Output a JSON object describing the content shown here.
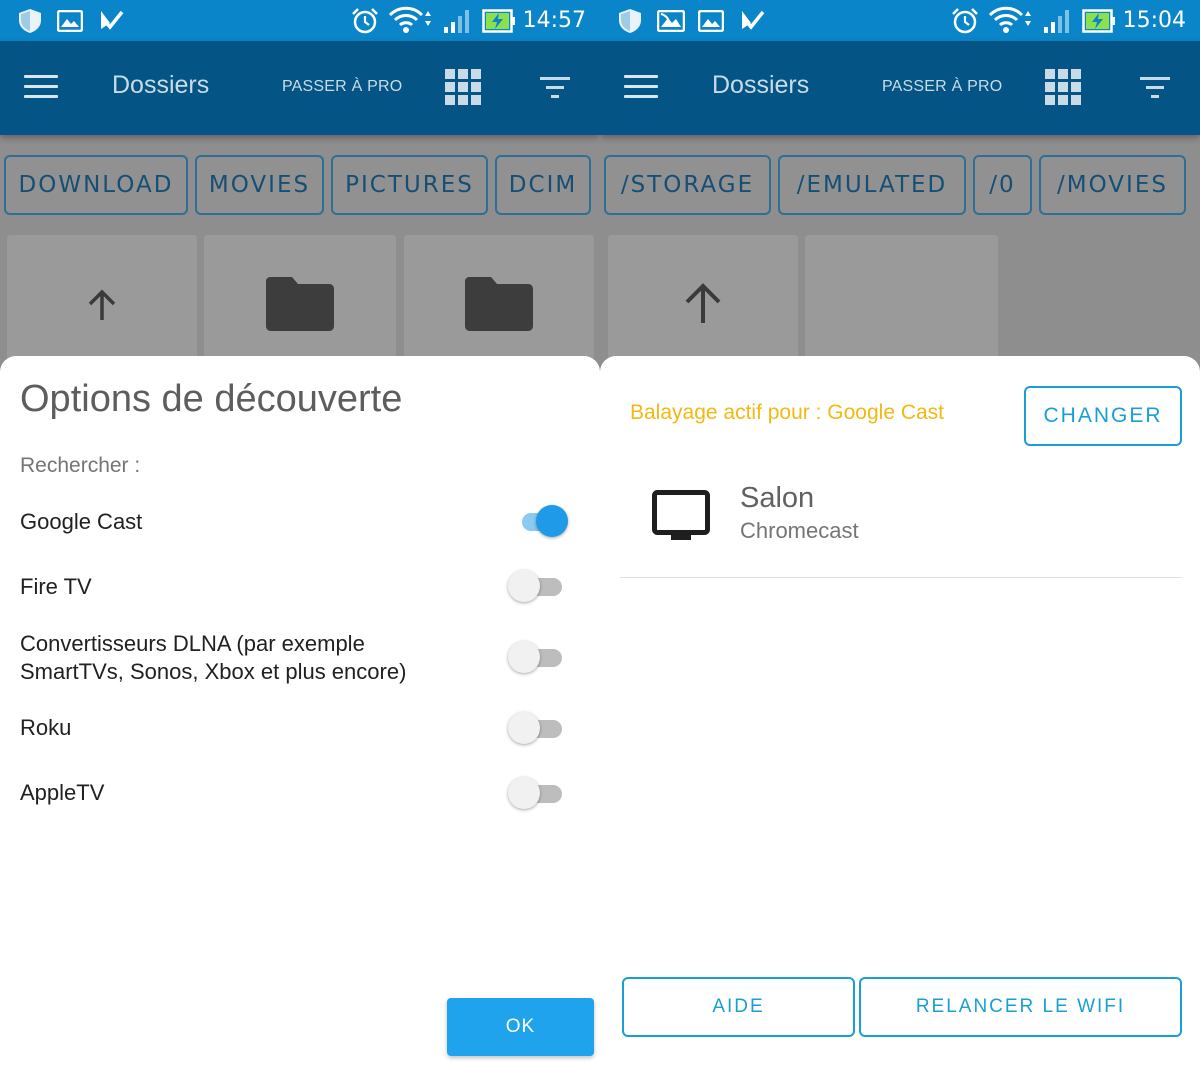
{
  "colors": {
    "status_bar": "#0b85c9",
    "app_bar": "#045585",
    "accent": "#1ea3ec",
    "scan_text": "#f3b814",
    "outline_button": "#1a9fd3"
  },
  "left": {
    "status": {
      "time": "14:57",
      "icons": [
        "shield-icon",
        "image-icon",
        "check-icon",
        "alarm-icon",
        "wifi-icon",
        "signal-icon",
        "battery-charging-icon"
      ]
    },
    "appbar": {
      "title": "Dossiers",
      "pro_label": "PASSER À PRO",
      "icons": [
        "menu-icon",
        "grid-view-icon",
        "filter-icon"
      ]
    },
    "breadcrumbs": [
      "DOWNLOAD",
      "MOVIES",
      "PICTURES",
      "DCIM"
    ],
    "tiles": [
      "arrow-up-icon",
      "folder-icon",
      "folder-icon"
    ],
    "dialog": {
      "title": "Options de découverte",
      "search_label": "Rechercher :",
      "options": [
        {
          "label": "Google Cast",
          "enabled": true
        },
        {
          "label": "Fire TV",
          "enabled": false
        },
        {
          "label_line1": "Convertisseurs DLNA (par exemple",
          "label_line2": "SmartTVs, Sonos, Xbox et plus encore)",
          "enabled": false
        },
        {
          "label": "Roku",
          "enabled": false
        },
        {
          "label": "AppleTV",
          "enabled": false
        }
      ],
      "ok_label": "OK"
    }
  },
  "right": {
    "status": {
      "time": "15:04",
      "icons": [
        "shield-icon",
        "cast-image-icon",
        "image-icon",
        "check-icon",
        "alarm-icon",
        "wifi-icon",
        "signal-icon",
        "battery-charging-icon"
      ]
    },
    "appbar": {
      "title": "Dossiers",
      "pro_label": "PASSER À PRO",
      "icons": [
        "menu-icon",
        "grid-view-icon",
        "filter-icon"
      ]
    },
    "breadcrumbs": [
      "/STORAGE",
      "/EMULATED",
      "/0",
      "/MOVIES"
    ],
    "tiles": [
      "arrow-up-icon"
    ],
    "dialog": {
      "scan_text": "Balayage actif pour : Google Cast",
      "change_label": "CHANGER",
      "device": {
        "name": "Salon",
        "type": "Chromecast",
        "icon": "tv-icon"
      },
      "help_label": "AIDE",
      "restart_wifi_label": "RELANCER LE WIFI"
    }
  }
}
